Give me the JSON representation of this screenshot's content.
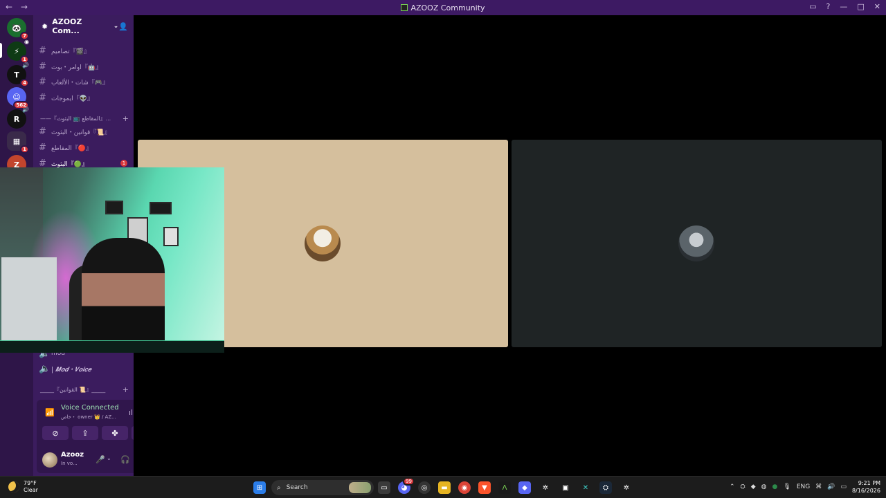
{
  "window": {
    "title": "AZOOZ Community",
    "back": "←",
    "forward": "→"
  },
  "guilds": [
    {
      "name": "guild-home",
      "badge": "7"
    },
    {
      "name": "guild-2",
      "badge": "1"
    },
    {
      "name": "guild-3",
      "badge": "4"
    },
    {
      "name": "guild-4",
      "badge": "562"
    },
    {
      "name": "guild-5",
      "badge": ""
    },
    {
      "name": "guild-6",
      "badge": "1"
    },
    {
      "name": "guild-7",
      "badge": ""
    }
  ],
  "server": {
    "name": "AZOOZ Com..."
  },
  "channels": [
    {
      "label": "تصاميم『🎬』",
      "badge": ""
    },
    {
      "label": "اوامر・بوت『🤖』",
      "badge": ""
    },
    {
      "label": "شات・الألعاب『🎮』",
      "badge": ""
    },
    {
      "label": "ايموجات『👽』",
      "badge": ""
    },
    {
      "label": "قوانين・البثوث『📜』",
      "badge": ""
    },
    {
      "label": "المقاطع『🔴』",
      "badge": ""
    },
    {
      "label": "البثوث『🟢』",
      "badge": "1"
    }
  ],
  "categories": [
    {
      "label": "——『المقاطع 📺 البثوث』..."
    },
    {
      "label": "_____『القوانين 📜』_____"
    }
  ],
  "voice_channels": [
    {
      "label": "mod"
    },
    {
      "label": "| 𝑴𝒐𝒅・𝑽𝒐𝒊𝒄𝒆"
    }
  ],
  "voice": {
    "status": "Voice Connected",
    "subtitle": "خاص・ owner 👑 / AZ...",
    "user": {
      "name": "Azooz",
      "status": "In vo..."
    }
  },
  "taskbar": {
    "weather_temp": "79°F",
    "weather_desc": "Clear",
    "search_label": "Search",
    "lang": "ENG",
    "time": "9:21 PM",
    "date": "8/16/2026",
    "discord_badge": "99"
  },
  "colors": {
    "titlebar": "#3d1a63",
    "guild_rail": "#2e1548",
    "sidebar": "#3b1c5e",
    "tile_a": "#d5bf9d",
    "tile_b": "#1f2425",
    "voice_connected": "#9fe3b4"
  }
}
